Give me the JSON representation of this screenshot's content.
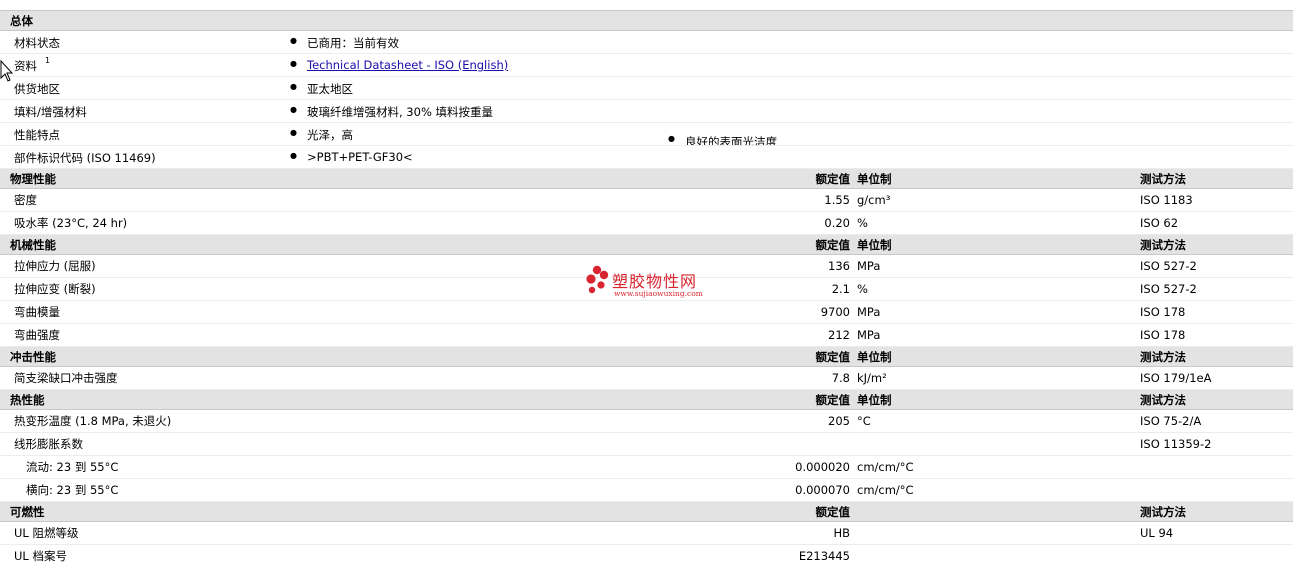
{
  "general": {
    "header": "总体",
    "rows": [
      {
        "label": "材料状态",
        "value": "已商用：当前有效"
      },
      {
        "label": "资料",
        "sup": "1",
        "value": "Technical Datasheet - ISO (English)"
      },
      {
        "label": "供货地区",
        "value": "亚太地区"
      },
      {
        "label": "填料/增强材料",
        "value": "玻璃纤维增强材料, 30% 填料按重量"
      },
      {
        "label": "性能特点",
        "value": "光泽，高",
        "value2": "良好的表面光洁度"
      },
      {
        "label": "部件标识代码 (ISO 11469)",
        "value": ">PBT+PET-GF30<"
      }
    ]
  },
  "col_headers": {
    "nominal": "额定值",
    "unit": "单位制",
    "method": "测试方法"
  },
  "sections": [
    {
      "title": "物理性能",
      "rows": [
        {
          "label": "密度",
          "value": "1.55",
          "unit": "g/cm³",
          "method": "ISO 1183"
        },
        {
          "label": "吸水率 (23°C, 24 hr)",
          "value": "0.20",
          "unit": "%",
          "method": "ISO 62"
        }
      ]
    },
    {
      "title": "机械性能",
      "rows": [
        {
          "label": "拉伸应力 (屈服)",
          "value": "136",
          "unit": "MPa",
          "method": "ISO 527-2"
        },
        {
          "label": "拉伸应变 (断裂)",
          "value": "2.1",
          "unit": "%",
          "method": "ISO 527-2"
        },
        {
          "label": "弯曲模量",
          "value": "9700",
          "unit": "MPa",
          "method": "ISO 178"
        },
        {
          "label": "弯曲强度",
          "value": "212",
          "unit": "MPa",
          "method": "ISO 178"
        }
      ]
    },
    {
      "title": "冲击性能",
      "rows": [
        {
          "label": "简支梁缺口冲击强度",
          "value": "7.8",
          "unit": "kJ/m²",
          "method": "ISO 179/1eA"
        }
      ]
    },
    {
      "title": "热性能",
      "rows": [
        {
          "label": "热变形温度 (1.8 MPa, 未退火)",
          "value": "205",
          "unit": "°C",
          "method": "ISO 75-2/A"
        },
        {
          "label": "线形膨胀系数",
          "value": "",
          "unit": "",
          "method": "ISO 11359-2"
        },
        {
          "label": "流动: 23 到 55°C",
          "value": "0.000020",
          "unit": "cm/cm/°C",
          "method": "",
          "sub": true
        },
        {
          "label": "横向: 23 到 55°C",
          "value": "0.000070",
          "unit": "cm/cm/°C",
          "method": "",
          "sub": true
        }
      ]
    },
    {
      "title": "可燃性",
      "unit_header": false,
      "rows": [
        {
          "label": "UL 阻燃等级",
          "value": "HB",
          "unit": "",
          "method": "UL 94"
        },
        {
          "label": "UL 档案号",
          "value": "E213445",
          "unit": "",
          "method": ""
        }
      ]
    }
  ],
  "watermark": {
    "title": "塑胶物性网",
    "url": "www.sujiaowuxing.com",
    "color": "#d8252f"
  }
}
